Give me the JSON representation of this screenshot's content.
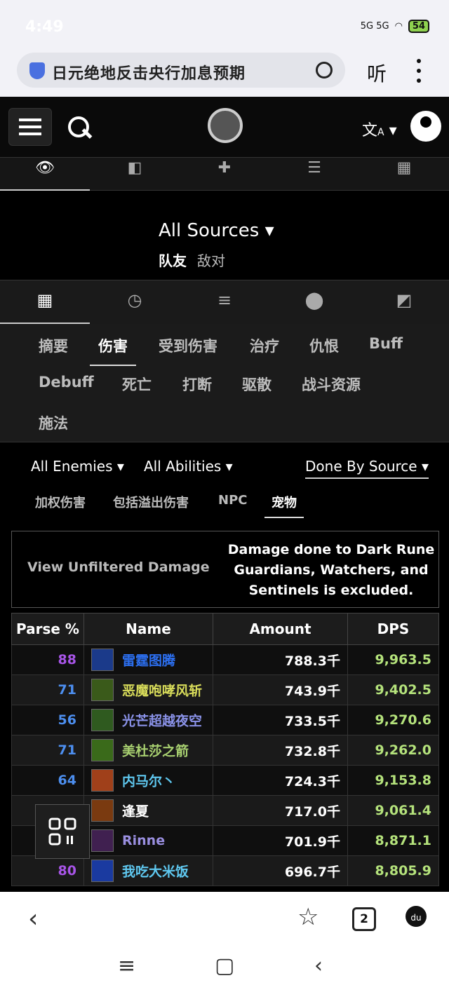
{
  "status_bar": {
    "time": "4:49",
    "network": "5G 5G",
    "battery": "54"
  },
  "browser": {
    "address_text": "日元绝地反击央行加息预期",
    "listen_label": "听",
    "tab_count": "2",
    "baidu_label": "du"
  },
  "view_tabs": [
    {
      "icon": "eye-icon",
      "glyph": "👁"
    },
    {
      "icon": "compare-icon",
      "glyph": "◧"
    },
    {
      "icon": "puzzle-icon",
      "glyph": "✚"
    },
    {
      "icon": "sort-icon",
      "glyph": "☰"
    },
    {
      "icon": "film-icon",
      "glyph": "▦"
    }
  ],
  "sources": {
    "title": "All Sources",
    "friendly": "队友",
    "enemy": "敌对"
  },
  "sub_tabs": [
    {
      "icon": "grid-icon",
      "glyph": "▦"
    },
    {
      "icon": "clock-icon",
      "glyph": "◷"
    },
    {
      "icon": "list-icon",
      "glyph": "≡"
    },
    {
      "icon": "pin-icon",
      "glyph": "⬤"
    },
    {
      "icon": "widgets-icon",
      "glyph": "◩"
    }
  ],
  "categories": [
    "摘要",
    "伤害",
    "受到伤害",
    "治疗",
    "仇恨",
    "Buff",
    "Debuff",
    "死亡",
    "打断",
    "驱散",
    "战斗资源",
    "施法"
  ],
  "filters": {
    "enemies": "All Enemies",
    "abilities": "All Abilities",
    "done_by": "Done By Source",
    "options": [
      "加权伤害",
      "包括溢出伤害",
      "NPC",
      "宠物"
    ]
  },
  "notice": {
    "unfiltered": "View Unfiltered Damage",
    "message": "Damage done to Dark Rune Guardians, Watchers, and Sentinels is excluded."
  },
  "table": {
    "headers": [
      "Parse %",
      "Name",
      "Amount",
      "DPS"
    ],
    "rows": [
      {
        "parse": "88",
        "name": "雷霆图腾",
        "amount": "788.3千",
        "dps": "9,963.5"
      },
      {
        "parse": "71",
        "name": "恶魔咆哮风斩",
        "amount": "743.9千",
        "dps": "9,402.5"
      },
      {
        "parse": "56",
        "name": "光芒超越夜空",
        "amount": "733.5千",
        "dps": "9,270.6"
      },
      {
        "parse": "71",
        "name": "美杜莎之箭",
        "amount": "732.8千",
        "dps": "9,262.0"
      },
      {
        "parse": "64",
        "name": "内马尔丶",
        "amount": "724.3千",
        "dps": "9,153.8"
      },
      {
        "parse": "",
        "name": "逢夏",
        "amount": "717.0千",
        "dps": "9,061.4"
      },
      {
        "parse": "",
        "name": "Rinne",
        "amount": "701.9千",
        "dps": "8,871.1"
      },
      {
        "parse": "80",
        "name": "我吃大米饭",
        "amount": "696.7千",
        "dps": "8,805.9"
      }
    ]
  },
  "colors": {
    "parse_purple": "#a855e8",
    "parse_blue": "#4d8ff0",
    "shaman": "#2c6ff0",
    "demon_hunter": "#d8dc5a",
    "druid": "#8a92e8",
    "hunter": "#a8d070",
    "mage": "#5fc8f0",
    "warlock": "#ffffff",
    "priest_purple": "#9a8fe0",
    "dps_green": "#b5e37c"
  }
}
